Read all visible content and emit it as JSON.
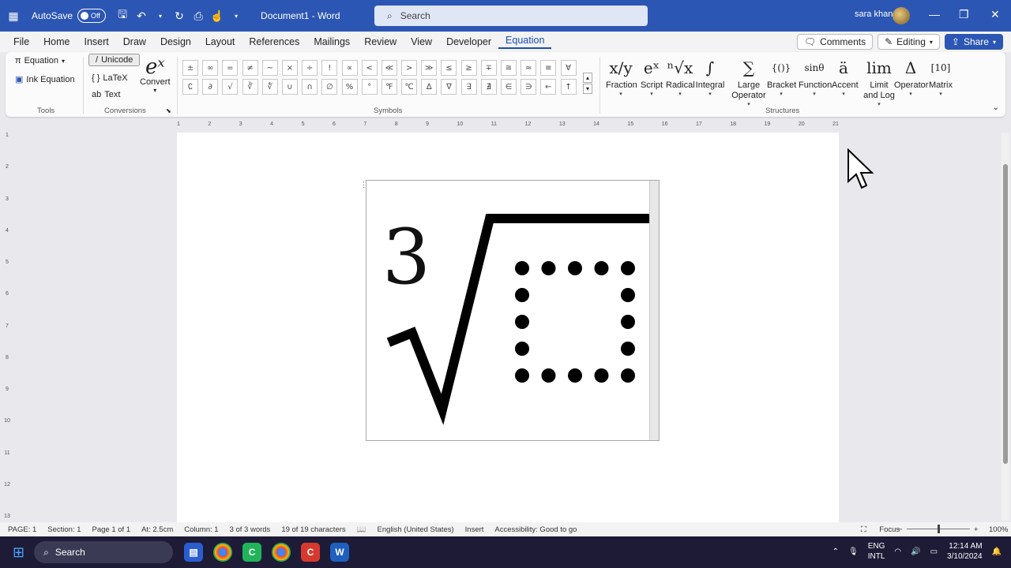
{
  "titlebar": {
    "autosave_label": "AutoSave",
    "autosave_state": "Off",
    "doc_title": "Document1  -  Word",
    "search_placeholder": "Search",
    "user_name": "sara khan"
  },
  "menu": [
    "File",
    "Home",
    "Insert",
    "Draw",
    "Design",
    "Layout",
    "References",
    "Mailings",
    "Review",
    "View",
    "Developer",
    "Equation"
  ],
  "active_menu": "Equation",
  "right_buttons": {
    "comments": "Comments",
    "editing": "Editing",
    "share": "Share"
  },
  "tools": {
    "equation": "Equation",
    "ink_equation": "Ink Equation",
    "label": "Tools"
  },
  "conversions": {
    "unicode": "Unicode",
    "latex": "LaTeX",
    "text": "Text",
    "convert": "Convert",
    "convert_glyph": "eˣ",
    "label": "Conversions"
  },
  "symbols": {
    "label": "Symbols",
    "row1": [
      "±",
      "∞",
      "=",
      "≠",
      "~",
      "×",
      "÷",
      "!",
      "∝",
      "<",
      "≪",
      ">",
      "≫",
      "≤",
      "≥",
      "∓",
      "≅",
      "≈",
      "≡",
      "∀"
    ],
    "row2": [
      "∁",
      "∂",
      "√",
      "∛",
      "∜",
      "∪",
      "∩",
      "∅",
      "%",
      "°",
      "℉",
      "℃",
      "∆",
      "∇",
      "∃",
      "∄",
      "∈",
      "∋",
      "←",
      "↑"
    ]
  },
  "structures": {
    "label": "Structures",
    "items": [
      {
        "label": "Fraction",
        "glyph": "x/y"
      },
      {
        "label": "Script",
        "glyph": "eˣ"
      },
      {
        "label": "Radical",
        "glyph": "ⁿ√x"
      },
      {
        "label": "Integral",
        "glyph": "∫"
      },
      {
        "label": "Large Operator",
        "glyph": "∑"
      },
      {
        "label": "Bracket",
        "glyph": "{()}"
      },
      {
        "label": "Function",
        "glyph": "sinθ"
      },
      {
        "label": "Accent",
        "glyph": "ä"
      },
      {
        "label": "Limit and Log",
        "glyph": "lim"
      },
      {
        "label": "Operator",
        "glyph": "Δ"
      },
      {
        "label": "Matrix",
        "glyph": "[10]"
      }
    ]
  },
  "ruler_numbers": [
    "1",
    "2",
    "3",
    "4",
    "5",
    "6",
    "7",
    "8",
    "9",
    "10",
    "11",
    "12",
    "13",
    "14",
    "15",
    "16",
    "17",
    "18",
    "19",
    "20",
    "21"
  ],
  "vruler_numbers": [
    "1",
    "2",
    "3",
    "4",
    "5",
    "6",
    "7",
    "8",
    "9",
    "10",
    "11",
    "12",
    "13"
  ],
  "equation": {
    "index": "3"
  },
  "status": {
    "page": "PAGE: 1",
    "section": "Section: 1",
    "pages": "Page 1 of 1",
    "at": "At: 2.5cm",
    "column": "Column: 1",
    "words": "3 of 3 words",
    "chars": "19 of 19 characters",
    "language": "English (United States)",
    "mode": "Insert",
    "accessibility": "Accessibility: Good to go",
    "focus": "Focus",
    "zoom": "100%"
  },
  "taskbar": {
    "search": "Search",
    "lang1": "ENG",
    "lang2": "INTL",
    "time": "12:14 AM",
    "date": "3/10/2024"
  }
}
